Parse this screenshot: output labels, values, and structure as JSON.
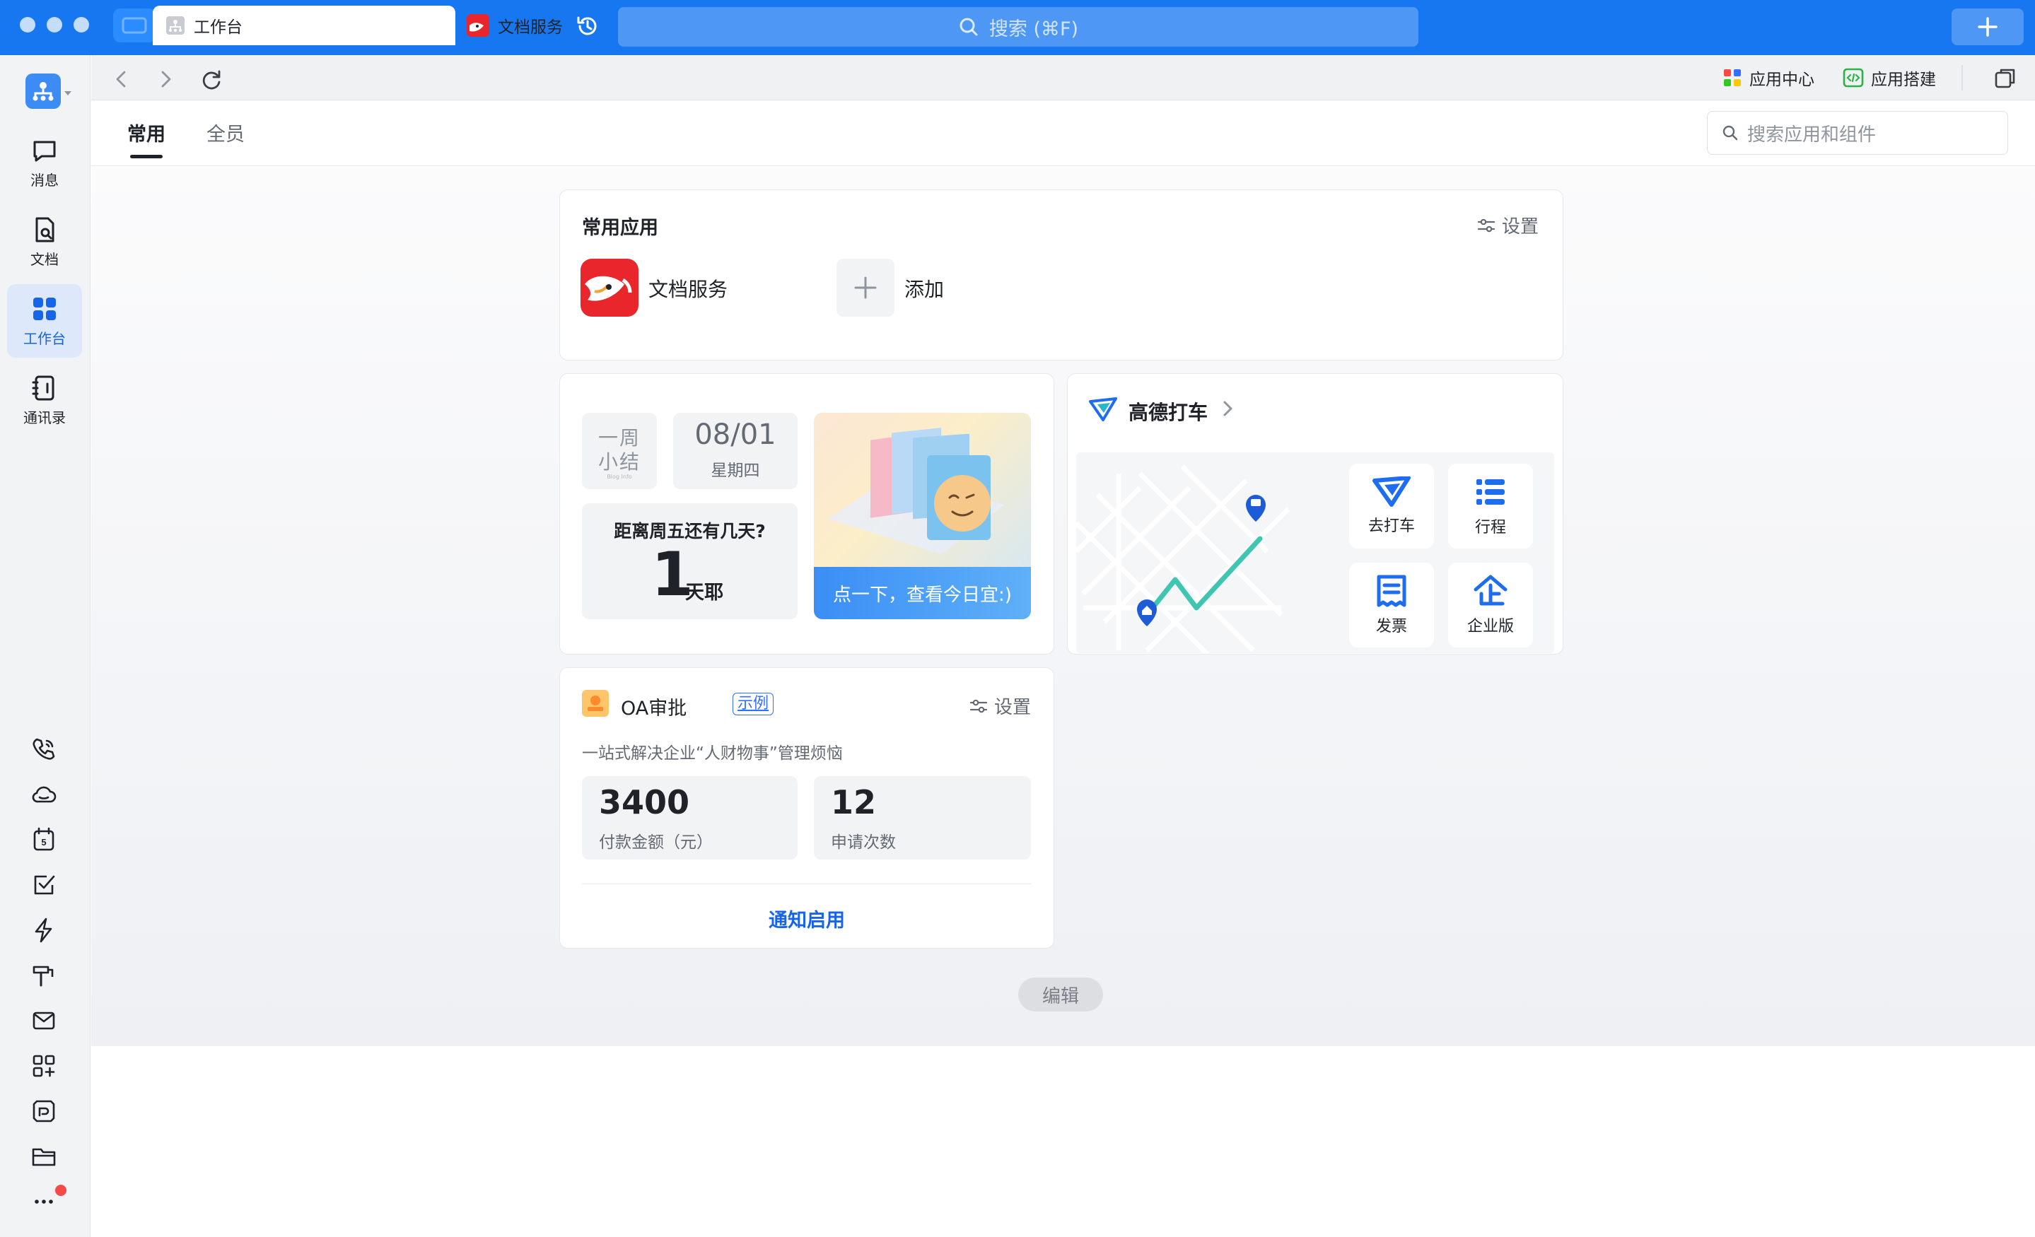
{
  "topbar": {
    "search_placeholder": "搜索 (⌘F)"
  },
  "sidebar": {
    "items": [
      {
        "label": "消息",
        "icon": "chat-bubble-icon"
      },
      {
        "label": "文档",
        "icon": "document-icon"
      },
      {
        "label": "工作台",
        "icon": "grid-icon",
        "active": true
      },
      {
        "label": "通讯录",
        "icon": "contacts-icon"
      }
    ],
    "bottom_icons": [
      "phone-icon",
      "cloud-icon",
      "calendar-icon",
      "task-check-icon",
      "lightning-icon",
      "hammer-icon",
      "mail-icon",
      "apps-plus-icon",
      "minutes-icon",
      "folder-icon",
      "more-icon"
    ],
    "calendar_day": "5"
  },
  "tabs": {
    "items": [
      {
        "label": "工作台",
        "icon": "workbench-icon"
      },
      {
        "label": "文档服务",
        "icon": "doc-service-icon"
      }
    ],
    "app_center": "应用中心",
    "app_builder": "应用搭建"
  },
  "subnav": {
    "tabs": [
      "常用",
      "全员"
    ],
    "active": "常用",
    "search_placeholder": "搜索应用和组件"
  },
  "common_apps": {
    "title": "常用应用",
    "settings": "设置",
    "apps": [
      {
        "name": "文档服务",
        "icon": "doc-service-logo"
      },
      {
        "name": "添加",
        "icon": "plus-icon"
      }
    ]
  },
  "weekly": {
    "logo_line1": "一周",
    "logo_line2": "小结",
    "logo_small": "Blog Info",
    "date": "08/01",
    "weekday": "星期四",
    "question": "距离周五还有几天?",
    "days": "1",
    "days_unit": "天耶",
    "banner_text": "点一下，查看今日宜:)"
  },
  "taxi": {
    "title": "高德打车",
    "tiles": [
      {
        "label": "去打车",
        "icon": "taxi-icon"
      },
      {
        "label": "行程",
        "icon": "list-icon"
      },
      {
        "label": "发票",
        "icon": "invoice-icon"
      },
      {
        "label": "企业版",
        "icon": "enterprise-icon"
      }
    ],
    "colors": {
      "accent": "#1e6cf0",
      "route": "#3ec6b0"
    }
  },
  "oa": {
    "title": "OA审批",
    "badge": "示例",
    "settings": "设置",
    "description": "一站式解决企业“人财物事”管理烦恼",
    "stats": [
      {
        "value": "3400",
        "label": "付款金额（元）"
      },
      {
        "value": "12",
        "label": "申请次数"
      }
    ],
    "action": "通知启用"
  },
  "edit_label": "编辑"
}
